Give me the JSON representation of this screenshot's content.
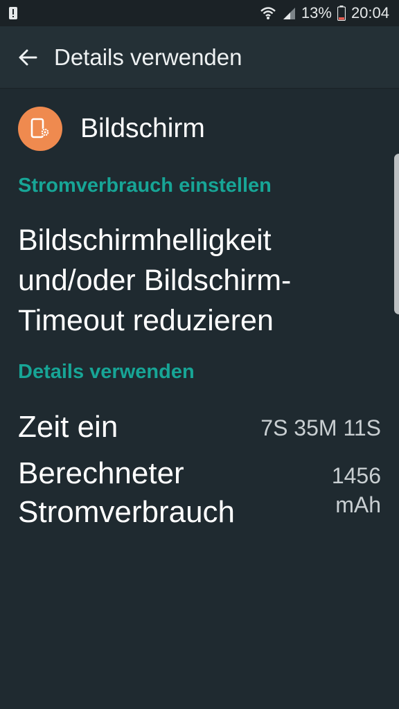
{
  "status_bar": {
    "battery_percent": "13%",
    "time": "20:04",
    "icons": [
      "alert-icon",
      "wifi-icon",
      "signal-icon",
      "battery-icon"
    ]
  },
  "app_bar": {
    "title": "Details verwenden",
    "back_icon": "arrow-left-icon"
  },
  "app": {
    "name": "Bildschirm",
    "icon": "screen-settings-icon",
    "icon_color": "#ef8a4f"
  },
  "sections": {
    "power_header": "Stromverbrauch einstellen",
    "power_tip": "Bildschirmhelligkeit und/oder Bildschirm-Timeout reduzieren",
    "details_header": "Details verwenden"
  },
  "details": [
    {
      "label": "Zeit ein",
      "value": "7S 35M 11S"
    },
    {
      "label": "Berechneter Stromverbrauch",
      "value": "1456 mAh"
    }
  ],
  "colors": {
    "background": "#1f2a30",
    "appbar": "#243036",
    "accent": "#17a596"
  }
}
